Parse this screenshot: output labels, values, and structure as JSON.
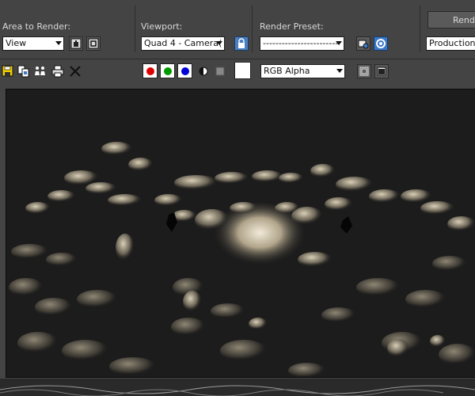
{
  "area_to_render": {
    "label": "Area to Render:",
    "value": "View"
  },
  "viewport": {
    "label": "Viewport:",
    "value": "Quad 4 - Camera("
  },
  "render_preset": {
    "label": "Render Preset:",
    "value": "------------------------"
  },
  "render_button": {
    "label": "Rende"
  },
  "production": {
    "value": "Production"
  },
  "channel_display": {
    "value": "RGB Alpha"
  },
  "colors": {
    "red_channel": "#e00000",
    "green_channel": "#009a00",
    "blue_channel": "#0000d8",
    "lock_button": "#4a7fc0",
    "settings_button": "#3a78c8"
  },
  "icons": {
    "save": "save-icon",
    "copy": "copy-image-icon",
    "clone": "clone-frame-window-icon",
    "print": "print-icon",
    "clear": "clear-icon",
    "region": "edit-region-icon",
    "auto_region": "auto-region-select-icon",
    "lock": "lock-icon",
    "environment": "environment-setup-icon",
    "render_setup": "render-setup-icon",
    "alpha": "display-alpha-icon",
    "mono": "monochrome-icon",
    "toggle_ui": "toggle-ui-overlay-icon",
    "toggle_ui2": "toggle-ui-icon"
  }
}
